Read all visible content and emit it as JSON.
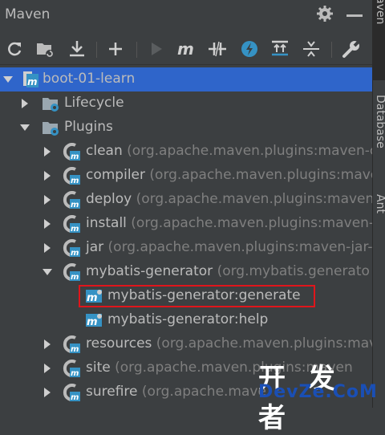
{
  "title": "Maven",
  "tree": {
    "root": {
      "label": "boot-01-learn"
    },
    "lifecycle": {
      "label": "Lifecycle"
    },
    "plugins": {
      "label": "Plugins"
    },
    "items": [
      {
        "name": "clean",
        "coords": "(org.apache.maven.plugins:maven-c"
      },
      {
        "name": "compiler",
        "coords": "(org.apache.maven.plugins:mave"
      },
      {
        "name": "deploy",
        "coords": "(org.apache.maven.plugins:maven"
      },
      {
        "name": "install",
        "coords": "(org.apache.maven.plugins:maven-"
      },
      {
        "name": "jar",
        "coords": "(org.apache.maven.plugins:maven-jar-"
      },
      {
        "name": "mybatis-generator",
        "coords": "(org.mybatis.generato"
      },
      {
        "name": "resources",
        "coords": "(org.apache.maven.plugins:mav"
      },
      {
        "name": "site",
        "coords": "(org.apache.maven.plugins:maven"
      },
      {
        "name": "surefire",
        "coords": "(org.apache.mave"
      }
    ],
    "goals": [
      {
        "label": "mybatis-generator:generate"
      },
      {
        "label": "mybatis-generator:help"
      }
    ]
  },
  "side_tabs": {
    "maven": "Maven",
    "database": "Database",
    "ant": "Ant"
  },
  "watermark": {
    "line1": "开 发 者",
    "line2": "DevZe.CoM"
  },
  "colors": {
    "selection": "#2f65ca",
    "highlight_border": "#e0151b",
    "accent_blue": "#3592c4"
  }
}
